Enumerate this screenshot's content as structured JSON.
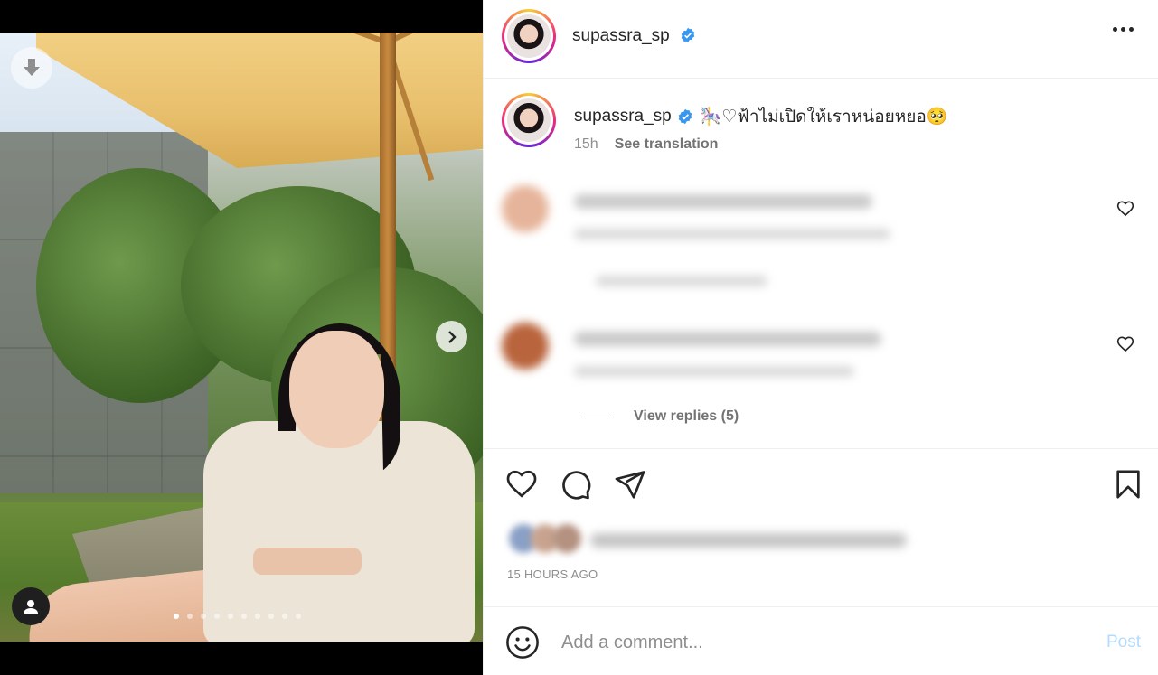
{
  "post": {
    "author": "supassra_sp",
    "caption_suffix": "🎠♡ฟ้าไม่เปิดให้เราหน่อยหยอ🥺",
    "caption_time": "15h",
    "see_translation": "See translation",
    "view_replies": "View replies (5)",
    "time_ago": "15 HOURS AGO",
    "carousel": {
      "count": 10,
      "active_index": 0
    }
  },
  "comment_box": {
    "placeholder": "Add a comment...",
    "post_label": "Post"
  },
  "icons": {
    "download": "download-arrow-icon",
    "next": "chevron-right-icon",
    "tags": "user-tag-icon",
    "verified": "verified-badge-icon",
    "more": "more-horizontal-icon",
    "like": "heart-icon",
    "comment": "comment-bubble-icon",
    "share": "paper-plane-icon",
    "save": "bookmark-icon",
    "emoji": "smiley-icon"
  },
  "colors": {
    "verified": "#3897f0",
    "post_button": "#b3dbff",
    "muted_text": "#8e8e8e"
  }
}
